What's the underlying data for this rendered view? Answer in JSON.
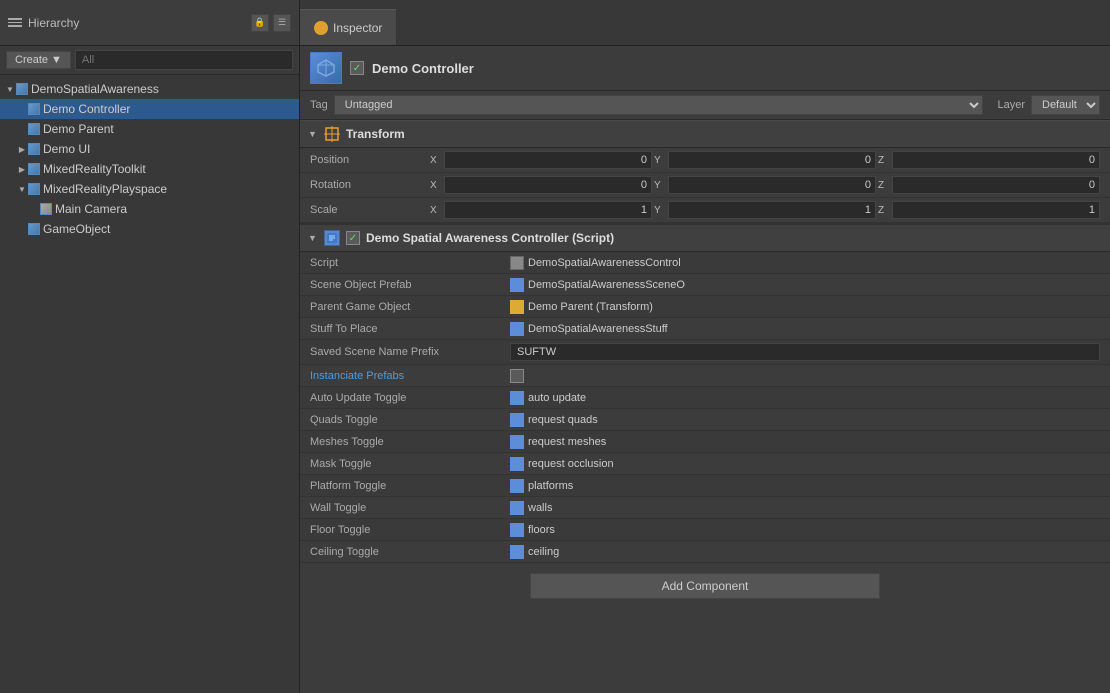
{
  "hierarchy": {
    "title": "Hierarchy",
    "create_btn": "Create",
    "search_placeholder": "All",
    "items": [
      {
        "id": "demo-spatial-awareness",
        "label": "DemoSpatialAwareness",
        "indent": 0,
        "expanded": true,
        "type": "root",
        "selected": false
      },
      {
        "id": "demo-controller",
        "label": "Demo Controller",
        "indent": 1,
        "expanded": false,
        "type": "cube",
        "selected": true
      },
      {
        "id": "demo-parent",
        "label": "Demo Parent",
        "indent": 1,
        "expanded": false,
        "type": "cube",
        "selected": false
      },
      {
        "id": "demo-ui",
        "label": "Demo UI",
        "indent": 1,
        "expanded": false,
        "type": "cube",
        "selected": false
      },
      {
        "id": "mixed-reality-toolkit",
        "label": "MixedRealityToolkit",
        "indent": 1,
        "expanded": false,
        "type": "cube",
        "selected": false
      },
      {
        "id": "mixed-reality-playspace",
        "label": "MixedRealityPlayspace",
        "indent": 1,
        "expanded": true,
        "type": "cube",
        "selected": false
      },
      {
        "id": "main-camera",
        "label": "Main Camera",
        "indent": 2,
        "expanded": false,
        "type": "camera",
        "selected": false
      },
      {
        "id": "game-object",
        "label": "GameObject",
        "indent": 1,
        "expanded": false,
        "type": "cube",
        "selected": false
      }
    ]
  },
  "inspector": {
    "tab_label": "Inspector",
    "object": {
      "name": "Demo Controller",
      "tag": "Untagged",
      "layer": "Default"
    },
    "transform": {
      "title": "Transform",
      "position": {
        "label": "Position",
        "x": "0",
        "y": "0",
        "z": "0"
      },
      "rotation": {
        "label": "Rotation",
        "x": "0",
        "y": "0",
        "z": "0"
      },
      "scale": {
        "label": "Scale",
        "x": "1",
        "y": "1",
        "z": "1"
      }
    },
    "script_component": {
      "title": "Demo Spatial Awareness Controller (Script)",
      "properties": [
        {
          "label": "Script",
          "value": "DemoSpatialAwarenessControl",
          "type": "script"
        },
        {
          "label": "Scene Object Prefab",
          "value": "DemoSpatialAwarenessSceneO",
          "type": "asset"
        },
        {
          "label": "Parent Game Object",
          "value": "Demo Parent (Transform)",
          "type": "asset-yellow"
        },
        {
          "label": "Stuff To Place",
          "value": "DemoSpatialAwarenessStuff",
          "type": "asset"
        },
        {
          "label": "Saved Scene Name Prefix",
          "value": "SUFTW",
          "type": "text"
        },
        {
          "label": "Instanciate Prefabs",
          "value": "",
          "type": "link-checkbox"
        },
        {
          "label": "Auto Update Toggle",
          "value": "auto update",
          "type": "asset"
        },
        {
          "label": "Quads Toggle",
          "value": "request quads",
          "type": "asset"
        },
        {
          "label": "Meshes Toggle",
          "value": "request meshes",
          "type": "asset"
        },
        {
          "label": "Mask Toggle",
          "value": "request occlusion",
          "type": "asset"
        },
        {
          "label": "Platform Toggle",
          "value": "platforms",
          "type": "asset"
        },
        {
          "label": "Wall Toggle",
          "value": "walls",
          "type": "asset"
        },
        {
          "label": "Floor Toggle",
          "value": "floors",
          "type": "asset"
        },
        {
          "label": "Ceiling Toggle",
          "value": "ceiling",
          "type": "asset"
        }
      ]
    },
    "add_component_label": "Add Component"
  }
}
